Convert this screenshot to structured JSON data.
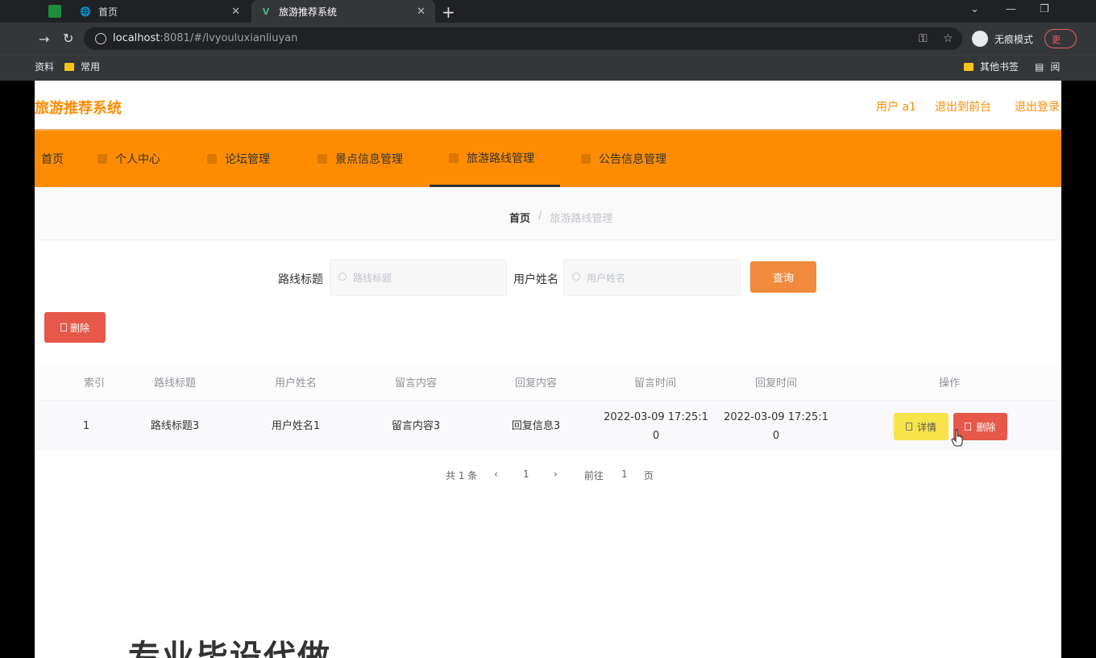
{
  "browser": {
    "tabs": [
      {
        "title": "首页",
        "icon": "globe-icon"
      },
      {
        "title": "旅游推荐系统",
        "icon": "vue-logo-icon"
      }
    ],
    "url_host": "localhost",
    "url_rest": ":8081/#/lvyouluxianliuyan",
    "incognito_label": "无痕模式",
    "pill_text": "更",
    "bookmarks_left": [
      "资料",
      "常用"
    ],
    "bookmarks_right": [
      "其他书签",
      "阅"
    ]
  },
  "site": {
    "title": "旅游推荐系统",
    "header_links": [
      "用户 a1",
      "退出到前台",
      "退出登录"
    ],
    "nav": [
      "首页",
      "个人中心",
      "论坛管理",
      "景点信息管理",
      "旅游路线管理",
      "公告信息管理"
    ],
    "active_nav": "旅游路线管理"
  },
  "breadcrumb": {
    "home": "首页",
    "separator": "/",
    "current": "旅游路线管理"
  },
  "search": {
    "label1": "路线标题",
    "placeholder1": "路线标题",
    "label2": "用户姓名",
    "placeholder2": "用户姓名",
    "query_label": "查询"
  },
  "toolbar": {
    "delete_label": "删除"
  },
  "table": {
    "headers": [
      "索引",
      "路线标题",
      "用户姓名",
      "留言内容",
      "回复内容",
      "留言时间",
      "回复时间",
      "操作"
    ],
    "rows": [
      {
        "index": "1",
        "title": "路线标题3",
        "user": "用户姓名1",
        "message": "留言内容3",
        "reply": "回复信息3",
        "message_time_l1": "2022-03-09 17:25:1",
        "message_time_l2": "0",
        "reply_time_l1": "2022-03-09 17:25:1",
        "reply_time_l2": "0",
        "detail_label": "详情",
        "delete_label": "删除"
      }
    ]
  },
  "pagination": {
    "total": "共 1 条",
    "prev": "‹",
    "page": "1",
    "next": "›",
    "goto": "前往",
    "goto_value": "1",
    "page_unit": "页"
  },
  "footer_text": "专业毕设代做",
  "colors": {
    "accent": "#ff8c00",
    "danger": "#e8584a",
    "warning": "#f7e34a"
  }
}
